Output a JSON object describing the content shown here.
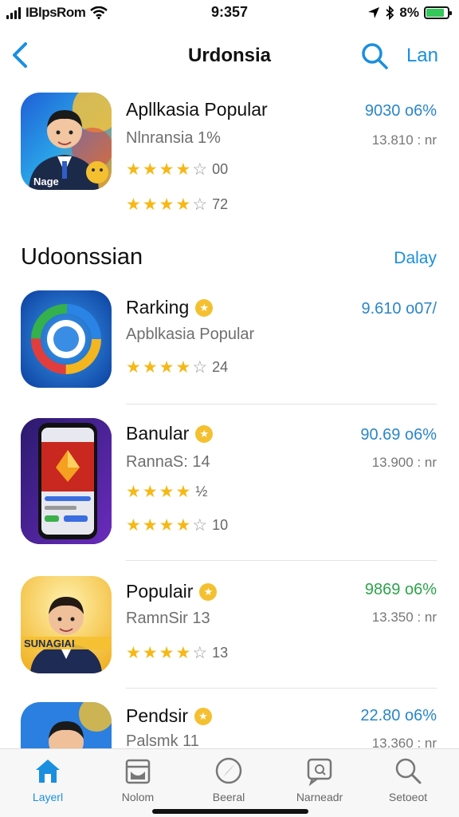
{
  "status_bar": {
    "carrier": "IBlpsRom",
    "time": "9:357",
    "battery_text": "8%"
  },
  "nav": {
    "title": "Urdonsia",
    "action": "Lan"
  },
  "featured": {
    "name": "Apllkasia Popular",
    "sub": "Nlnransia 1%",
    "icon_text": "Nage",
    "value": "9030 o6%",
    "meta": "13.810 : nr",
    "rating1": "00",
    "rating2": "72"
  },
  "section": {
    "title": "Udoonssian",
    "link": "Dalay"
  },
  "apps": [
    {
      "name": "Rarking",
      "sub": "Apblkasia Popular",
      "value": "9.610 o07/",
      "rating1": "24"
    },
    {
      "name": "Banular",
      "sub": "RannaS: 14",
      "value": "90.69 o6%",
      "meta": "13.900 : nr",
      "rating1": "½",
      "rating2": "10"
    },
    {
      "name": "Populair",
      "sub": "RamnSir 13",
      "value": "9869 o6%",
      "meta": "13.350 : nr",
      "rating1": "13",
      "icon_text": "SUNAGIAI"
    },
    {
      "name": "Pendsir",
      "sub": "Palsmk 11",
      "value": "22.80 o6%",
      "meta": "13.360 : nr"
    }
  ],
  "tabs": [
    {
      "label": "Layerl",
      "icon": "home-icon"
    },
    {
      "label": "Nolom",
      "icon": "folder-icon"
    },
    {
      "label": "Beeral",
      "icon": "compass-icon"
    },
    {
      "label": "Narneadr",
      "icon": "chat-icon"
    },
    {
      "label": "Setoeot",
      "icon": "search-icon"
    }
  ],
  "colors": {
    "accent": "#1a8fe0",
    "star": "#f5b817",
    "green": "#2da34a"
  }
}
